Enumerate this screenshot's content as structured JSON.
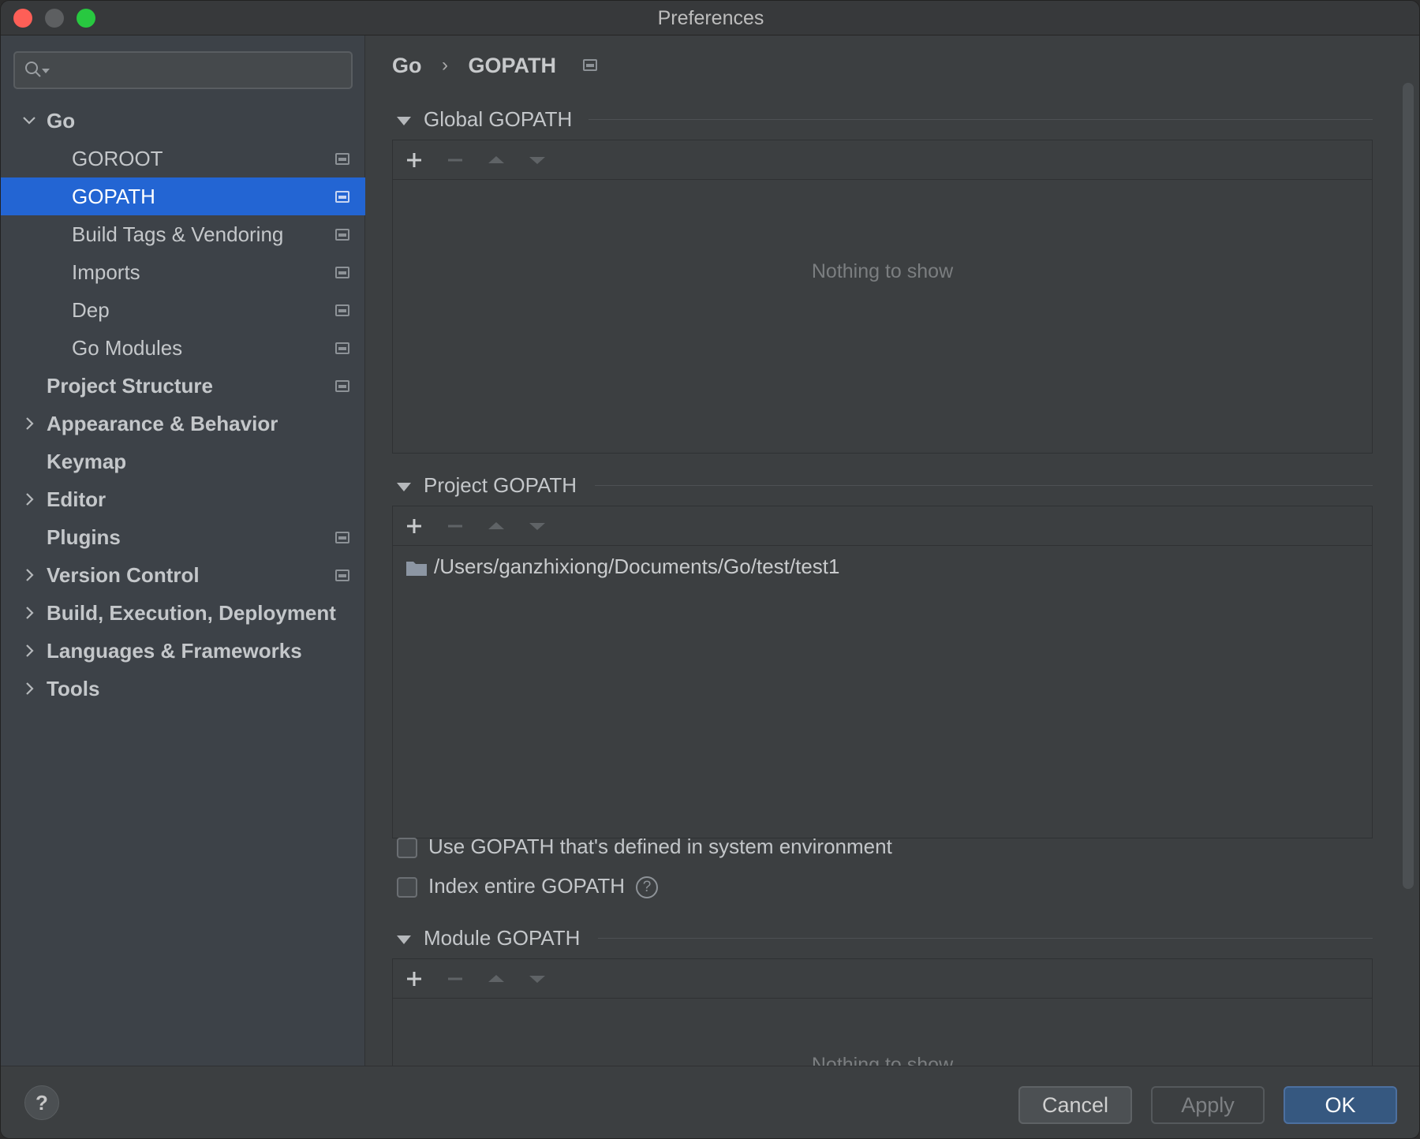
{
  "window": {
    "title": "Preferences"
  },
  "search": {
    "placeholder": ""
  },
  "sidebar": {
    "items": [
      {
        "label": "Go",
        "expanded": true
      },
      {
        "label": "GOROOT"
      },
      {
        "label": "GOPATH",
        "selected": true
      },
      {
        "label": "Build Tags & Vendoring"
      },
      {
        "label": "Imports"
      },
      {
        "label": "Dep"
      },
      {
        "label": "Go Modules"
      },
      {
        "label": "Project Structure"
      },
      {
        "label": "Appearance & Behavior",
        "expandable": true
      },
      {
        "label": "Keymap"
      },
      {
        "label": "Editor",
        "expandable": true
      },
      {
        "label": "Plugins"
      },
      {
        "label": "Version Control",
        "expandable": true
      },
      {
        "label": "Build, Execution, Deployment",
        "expandable": true
      },
      {
        "label": "Languages & Frameworks",
        "expandable": true
      },
      {
        "label": "Tools",
        "expandable": true
      }
    ]
  },
  "breadcrumb": {
    "parent": "Go",
    "separator": "›",
    "current": "GOPATH"
  },
  "global_gopath": {
    "title": "Global GOPATH",
    "empty_text": "Nothing to show"
  },
  "project_gopath": {
    "title": "Project GOPATH",
    "paths": [
      "/Users/ganzhixiong/Documents/Go/test/test1"
    ]
  },
  "options": {
    "use_system_env": {
      "label": "Use GOPATH that's defined in system environment",
      "checked": false
    },
    "index_entire": {
      "label": "Index entire GOPATH",
      "checked": false
    }
  },
  "module_gopath": {
    "title": "Module GOPATH",
    "empty_text": "Nothing to show"
  },
  "footer": {
    "help": "?",
    "cancel": "Cancel",
    "apply": "Apply",
    "ok": "OK"
  },
  "colors": {
    "selection": "#2365d3",
    "ok_button": "#365880",
    "background": "#3c3f41",
    "sidebar": "#3d4248"
  }
}
